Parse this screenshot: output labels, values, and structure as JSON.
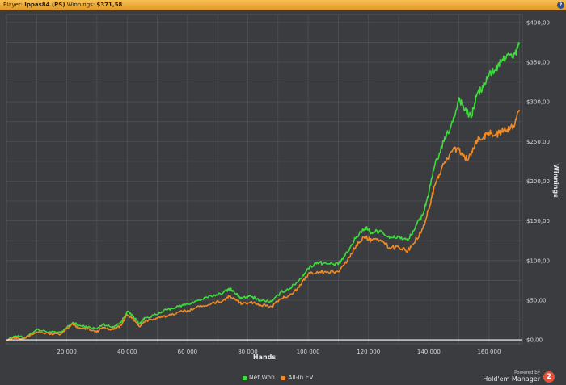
{
  "header": {
    "player_label": "Player:",
    "player_name": "Ippas84 (PS)",
    "winnings_label": "Winnings:",
    "winnings_value": "$371,58",
    "help_icon": "question-icon"
  },
  "legend": {
    "net_won": "Net Won",
    "allin_ev": "All-In EV"
  },
  "branding": {
    "powered_by": "Powered by",
    "product": "Hold'em Manager",
    "version_badge": "2"
  },
  "colors": {
    "background": "#3a3c40",
    "grid": "#50535a",
    "net_won": "#3ddc3a",
    "allin_ev": "#f08a24",
    "zero_line": "#ffffff"
  },
  "chart_data": {
    "type": "line",
    "xlabel": "Hands",
    "ylabel": "Winnings",
    "xlim": [
      0,
      171000
    ],
    "ylim": [
      -5,
      410
    ],
    "x_ticks": [
      20000,
      40000,
      60000,
      80000,
      100000,
      120000,
      140000,
      160000
    ],
    "x_tick_labels": [
      "20 000",
      "40 000",
      "60 000",
      "80 000",
      "100 000",
      "120 000",
      "140 000",
      "160 000"
    ],
    "y_ticks": [
      0,
      50,
      100,
      150,
      200,
      250,
      300,
      350,
      400
    ],
    "y_tick_labels": [
      "$0,00",
      "$50,00",
      "$100,00",
      "$150,00",
      "$200,00",
      "$250,00",
      "$300,00",
      "$350,00",
      "$400,00"
    ],
    "grid": true,
    "legend_position": "bottom-center",
    "series": [
      {
        "name": "Net Won",
        "color": "#3ddc3a",
        "x": [
          0,
          3000,
          6000,
          10000,
          14000,
          18000,
          22000,
          24000,
          27000,
          30000,
          32000,
          35000,
          38000,
          40000,
          42000,
          44000,
          46000,
          50000,
          53000,
          57000,
          60000,
          64000,
          68000,
          72000,
          74000,
          76000,
          78000,
          81000,
          84000,
          88000,
          91000,
          94000,
          97000,
          100000,
          103000,
          106000,
          110000,
          113000,
          116000,
          119000,
          121000,
          124000,
          127000,
          130000,
          133000,
          136000,
          138000,
          140000,
          142000,
          145000,
          148000,
          150000,
          152000,
          154000,
          156000,
          158000,
          160000,
          162000,
          164000,
          166000,
          168000,
          170000
        ],
        "y": [
          0,
          5,
          3,
          13,
          10,
          9,
          22,
          18,
          16,
          14,
          20,
          16,
          22,
          36,
          30,
          20,
          28,
          32,
          38,
          42,
          45,
          50,
          55,
          60,
          65,
          58,
          52,
          55,
          50,
          48,
          60,
          65,
          75,
          90,
          98,
          96,
          95,
          110,
          130,
          142,
          135,
          138,
          128,
          130,
          125,
          145,
          158,
          185,
          220,
          250,
          275,
          305,
          290,
          280,
          310,
          318,
          335,
          340,
          350,
          360,
          355,
          372
        ]
      },
      {
        "name": "All-In EV",
        "color": "#f08a24",
        "x": [
          0,
          3000,
          6000,
          10000,
          14000,
          18000,
          22000,
          24000,
          27000,
          30000,
          32000,
          35000,
          38000,
          40000,
          42000,
          44000,
          46000,
          50000,
          53000,
          57000,
          60000,
          64000,
          68000,
          72000,
          74000,
          76000,
          78000,
          81000,
          84000,
          88000,
          91000,
          94000,
          97000,
          100000,
          103000,
          106000,
          110000,
          113000,
          116000,
          119000,
          121000,
          124000,
          127000,
          130000,
          133000,
          136000,
          138000,
          140000,
          142000,
          145000,
          148000,
          150000,
          152000,
          154000,
          156000,
          158000,
          160000,
          162000,
          164000,
          166000,
          168000,
          170000
        ],
        "y": [
          0,
          3,
          2,
          10,
          8,
          7,
          20,
          15,
          14,
          10,
          16,
          13,
          18,
          32,
          26,
          17,
          24,
          27,
          30,
          35,
          37,
          42,
          46,
          50,
          55,
          50,
          45,
          48,
          44,
          42,
          52,
          57,
          66,
          83,
          86,
          85,
          86,
          100,
          120,
          130,
          125,
          126,
          116,
          117,
          112,
          128,
          140,
          165,
          195,
          222,
          240,
          240,
          228,
          232,
          252,
          255,
          262,
          258,
          262,
          265,
          270,
          290
        ]
      }
    ]
  }
}
